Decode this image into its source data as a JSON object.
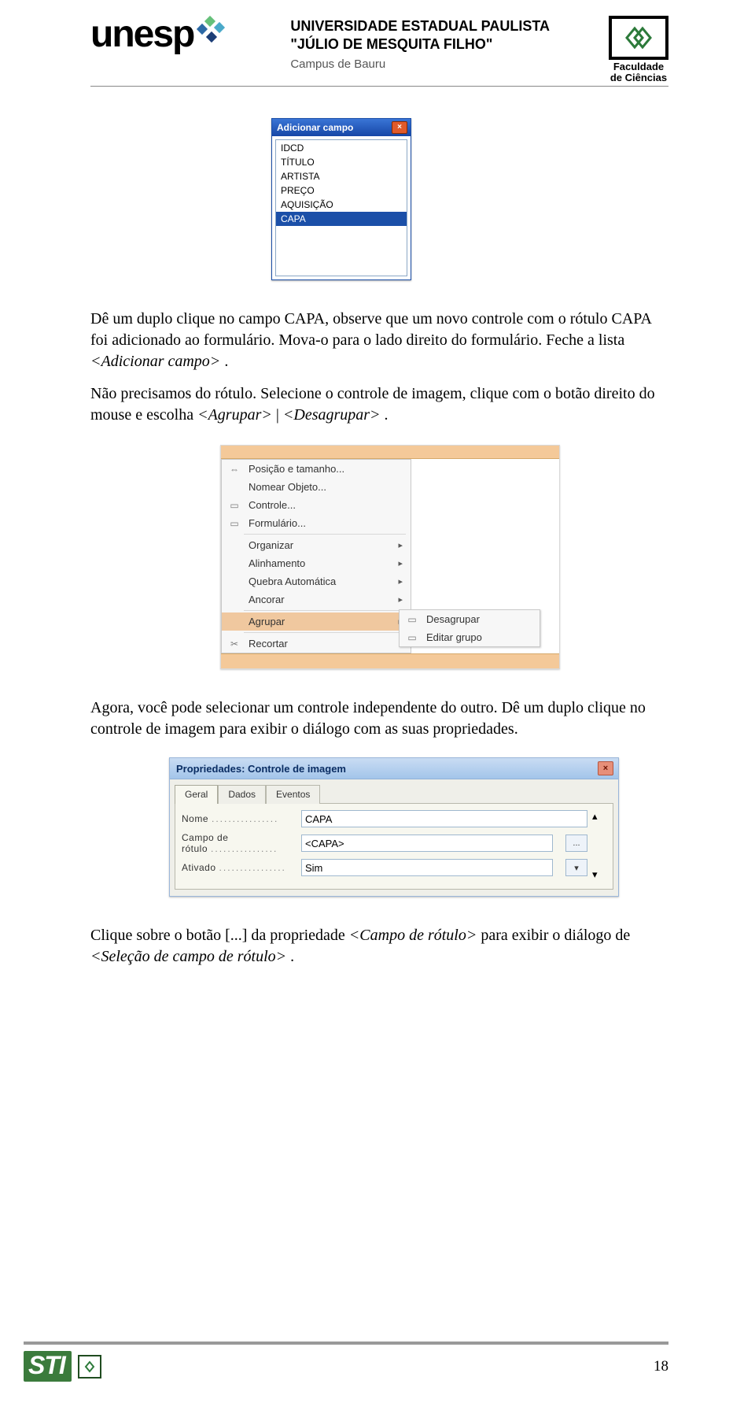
{
  "header": {
    "logo_text": "unesp",
    "center_line1": "UNIVERSIDADE ESTADUAL PAULISTA",
    "center_line2": "\"JÚLIO DE MESQUITA FILHO\"",
    "center_line3": "Campus de Bauru",
    "fc_line1": "Faculdade",
    "fc_line2": "de Ciências"
  },
  "addfield_dialog": {
    "title": "Adicionar campo",
    "close": "×",
    "items": [
      "IDCD",
      "TÍTULO",
      "ARTISTA",
      "PREÇO",
      "AQUISIÇÃO",
      "CAPA"
    ],
    "selected_index": 5
  },
  "para1": {
    "t1": "Dê um duplo clique no campo CAPA, observe que um novo controle com o rótulo CAPA foi adicionado ao formulário. Mova-o para o lado direito do formulário. Feche a lista ",
    "i1": "<Adicionar campo>",
    "t2": "."
  },
  "para2": {
    "t1": "Não precisamos do rótulo. Selecione o controle de imagem, clique com o botão direito do mouse e escolha ",
    "i1": "<Agrupar>",
    "t2": " | ",
    "i2": "<Desagrupar>",
    "t3": "."
  },
  "context_menu": {
    "items": [
      {
        "icon": "⇔",
        "label": "Posição e tamanho...",
        "u": "P"
      },
      {
        "icon": "",
        "label": "Nomear Objeto...",
        "u": "N"
      },
      {
        "icon": "▭",
        "label": "Controle...",
        "u": "C"
      },
      {
        "icon": "▭",
        "label": "Formulário...",
        "u": "F"
      }
    ],
    "items2": [
      {
        "label": "Organizar",
        "arrow": true
      },
      {
        "label": "Alinhamento",
        "u": "A",
        "arrow": true
      },
      {
        "label": "Quebra Automática",
        "u": "Q",
        "arrow": true
      },
      {
        "label": "Ancorar",
        "u": "n",
        "arrow": true
      }
    ],
    "agrupar": {
      "label": "Agrupar",
      "u": "A",
      "arrow": true
    },
    "submenu": [
      {
        "icon": "▭",
        "label": "Desagrupar",
        "u": "D"
      },
      {
        "icon": "▭",
        "label": "Editar grupo",
        "u": "E"
      }
    ],
    "recortar": {
      "icon": "✂",
      "label": "Recortar"
    }
  },
  "para3": {
    "t1": "Agora, você pode selecionar um controle independente do outro. Dê um duplo clique no controle de imagem para exibir o diálogo com as suas propriedades."
  },
  "properties_dialog": {
    "title": "Propriedades: Controle de imagem",
    "close": "×",
    "tabs": [
      "Geral",
      "Dados",
      "Eventos"
    ],
    "active_tab": 0,
    "rows": {
      "nome_label": "Nome",
      "nome_value": "CAPA",
      "rotulo_label": "Campo de rótulo",
      "rotulo_value": "<CAPA>",
      "rotulo_btn": "...",
      "ativado_label": "Ativado",
      "ativado_value": "Sim"
    },
    "scroll_up": "▴",
    "scroll_dn": "▾",
    "dropdown": "▾"
  },
  "para4": {
    "t1": "Clique sobre o botão [...] da propriedade ",
    "i1": "<Campo de rótulo>",
    "t2": " para exibir o diálogo de ",
    "i2": "<Seleção de campo de rótulo>",
    "t3": "."
  },
  "footer": {
    "sti": "STI",
    "page": "18"
  }
}
